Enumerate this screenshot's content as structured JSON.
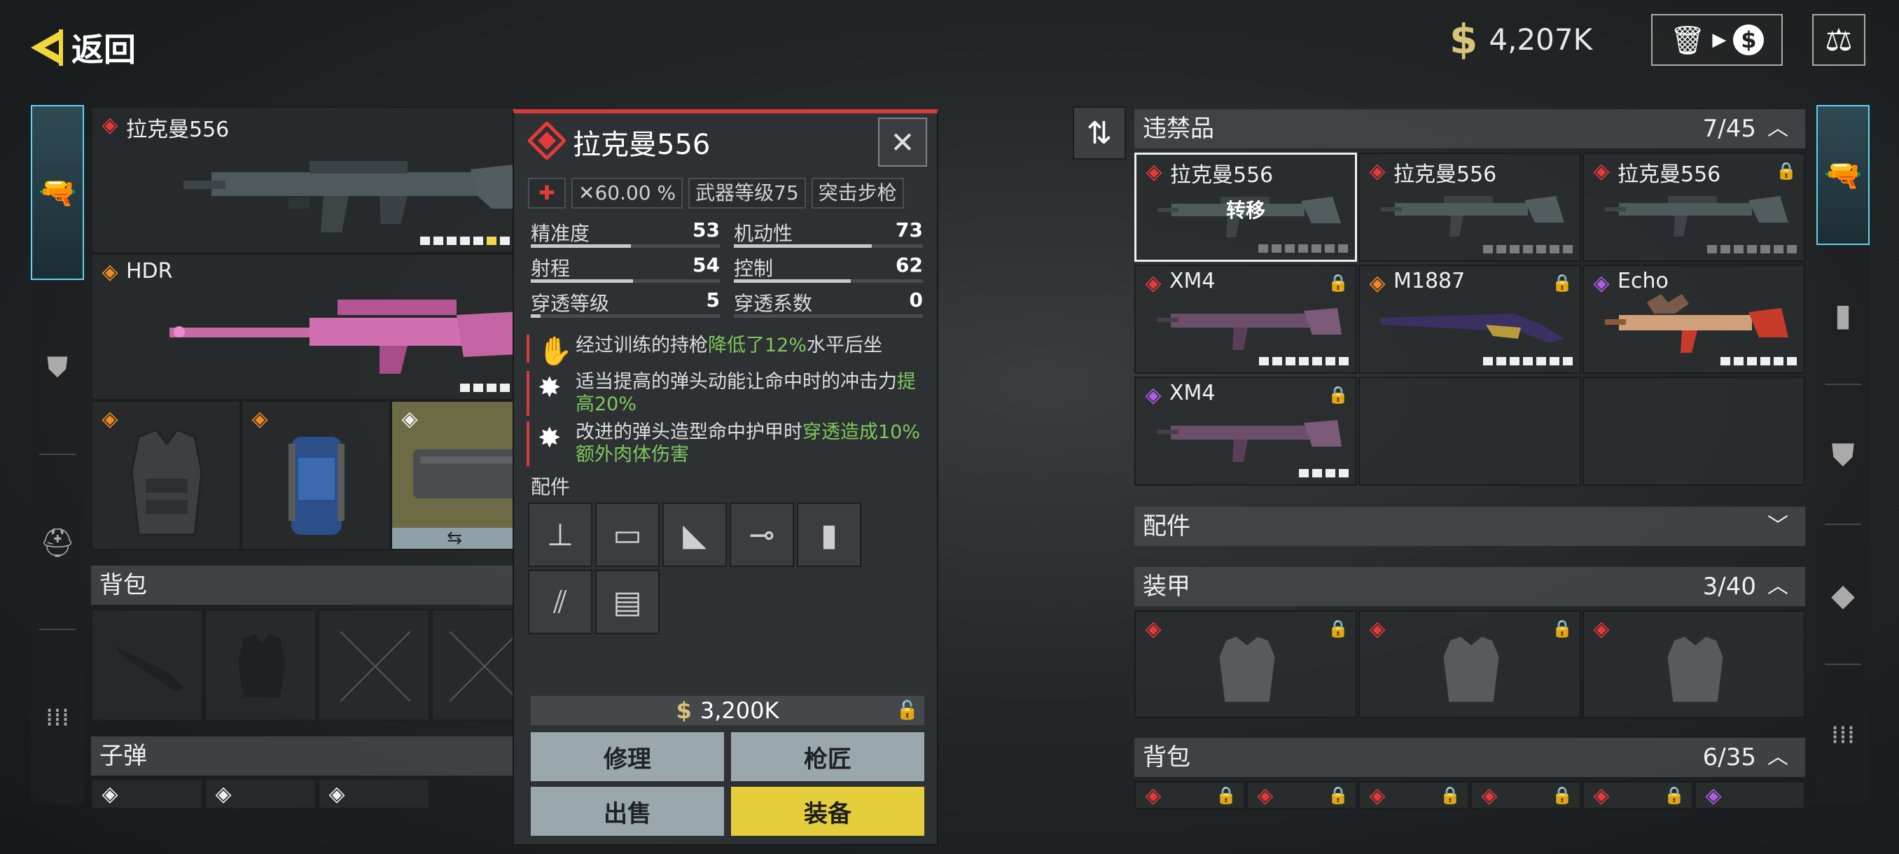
{
  "header": {
    "back_label": "返回",
    "money": "4,207K",
    "currency_symbol": "$"
  },
  "left_slots": {
    "primary": {
      "name": "拉克曼556",
      "rarity": "red"
    },
    "secondary": {
      "name": "HDR",
      "rarity": "orange"
    },
    "gear": [
      {
        "rarity": "orange"
      },
      {
        "rarity": "orange"
      },
      {
        "rarity": "white"
      }
    ],
    "swap_symbol": "⇆",
    "backpack_label": "背包",
    "ammo_label": "子弹"
  },
  "popup": {
    "title": "拉克曼556",
    "tags": [
      "✕60.00 %",
      "武器等级75",
      "突击步枪"
    ],
    "stats": [
      {
        "label": "精准度",
        "value": "53",
        "fill": 0.53
      },
      {
        "label": "机动性",
        "value": "73",
        "fill": 0.73
      },
      {
        "label": "射程",
        "value": "54",
        "fill": 0.54
      },
      {
        "label": "控制",
        "value": "62",
        "fill": 0.62
      },
      {
        "label": "穿透等级",
        "value": "5",
        "fill": 0.05
      },
      {
        "label": "穿透系数",
        "value": "0",
        "fill": 0.0
      }
    ],
    "perks": [
      {
        "pre": "经过训练的持枪",
        "hl": "降低了12%",
        "post": "水平后坐"
      },
      {
        "pre": "适当提高的弹头动能让命中时的冲击力",
        "hl": "提高20%",
        "post": ""
      },
      {
        "pre": "改进的弹头造型命中护甲时",
        "hl": "穿透造成10%额外肉体伤害",
        "post": ""
      }
    ],
    "attachments_label": "配件",
    "price": "3,200K",
    "buttons": {
      "repair": "修理",
      "gunsmith": "枪匠",
      "sell": "出售",
      "equip": "装备"
    }
  },
  "stash": {
    "contraband": {
      "label": "违禁品",
      "count": "7/45"
    },
    "items": [
      {
        "name": "拉克曼556",
        "rarity": "red",
        "selected": true,
        "overlay": "转移"
      },
      {
        "name": "拉克曼556",
        "rarity": "red"
      },
      {
        "name": "拉克曼556",
        "rarity": "red"
      },
      {
        "name": "XM4",
        "rarity": "red"
      },
      {
        "name": "M1887",
        "rarity": "orange"
      },
      {
        "name": "Echo",
        "rarity": "purple"
      },
      {
        "name": "XM4",
        "rarity": "purple"
      }
    ],
    "attachments": {
      "label": "配件"
    },
    "armor": {
      "label": "装甲",
      "count": "3/40"
    },
    "backpack": {
      "label": "背包",
      "count": "6/35"
    }
  }
}
